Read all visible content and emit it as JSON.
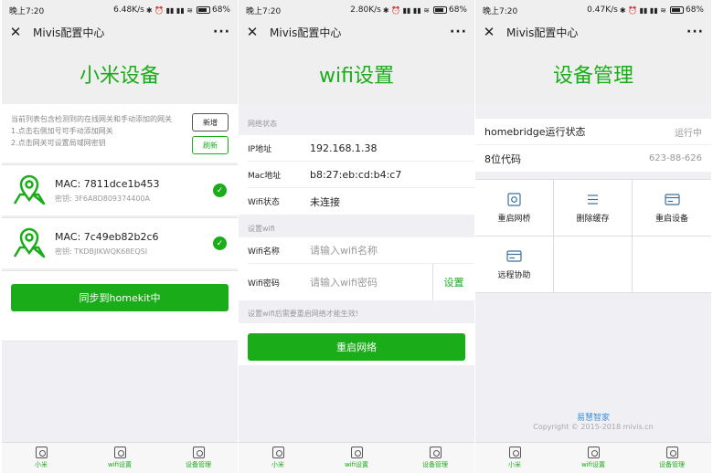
{
  "colors": {
    "accent": "#1aad19",
    "link": "#3b8fd6"
  },
  "screens": [
    {
      "status": {
        "time": "晚上7:20",
        "speed": "6.48K/s",
        "battery": "68%"
      },
      "nav": {
        "title": "Mivis配置中心"
      },
      "hero": "小米设备",
      "tips": {
        "line1": "当前列表包含检测到的在线网关和手动添加的网关",
        "line2": "1.点击右侧加号可手动添加网关",
        "line3": "2.点击网关可设置局域网密钥"
      },
      "add_label": "新增",
      "refresh_label": "刷新",
      "devices": [
        {
          "mac": "MAC: 7811dce1b453",
          "key": "密钥: 3F6A8D809374400A"
        },
        {
          "mac": "MAC: 7c49eb82b2c6",
          "key": "密钥: TKDBJIKWQK68EQSI"
        }
      ],
      "sync_label": "同步到homekit中"
    },
    {
      "status": {
        "time": "晚上7:20",
        "speed": "2.80K/s",
        "battery": "68%"
      },
      "nav": {
        "title": "Mivis配置中心"
      },
      "hero": "wifi设置",
      "network_section": "网络状态",
      "rows": [
        {
          "label": "IP地址",
          "value": "192.168.1.38"
        },
        {
          "label": "Mac地址",
          "value": "b8:27:eb:cd:b4:c7"
        },
        {
          "label": "Wifi状态",
          "value": "未连接"
        }
      ],
      "wifi_section": "设置wifi",
      "ssid": {
        "label": "Wifi名称",
        "placeholder": "请输入wifi名称"
      },
      "password": {
        "label": "Wifi密码",
        "placeholder": "请输入wifi密码",
        "button": "设置"
      },
      "note": "设置wifi后需要重启网络才能生效!",
      "restart_label": "重启网络"
    },
    {
      "status": {
        "time": "晚上7:20",
        "speed": "0.47K/s",
        "battery": "68%"
      },
      "nav": {
        "title": "Mivis配置中心"
      },
      "hero": "设备管理",
      "info": [
        {
          "label": "homebridge运行状态",
          "value": "运行中"
        },
        {
          "label": "8位代码",
          "value": "623-88-626"
        }
      ],
      "actions": [
        {
          "label": "重启网桥",
          "icon": "restart-bridge-icon"
        },
        {
          "label": "删除缓存",
          "icon": "list-icon"
        },
        {
          "label": "重启设备",
          "icon": "card-icon"
        },
        {
          "label": "远程协助",
          "icon": "card-icon"
        }
      ],
      "brand": "易慧智家",
      "copyright": "Copyright © 2015-2018 mivis.cn"
    }
  ],
  "tabs": [
    {
      "label": "小米",
      "icon": "xiaomi-tab-icon"
    },
    {
      "label": "wifi设置",
      "icon": "wifi-tab-icon"
    },
    {
      "label": "设备管理",
      "icon": "device-tab-icon"
    }
  ]
}
